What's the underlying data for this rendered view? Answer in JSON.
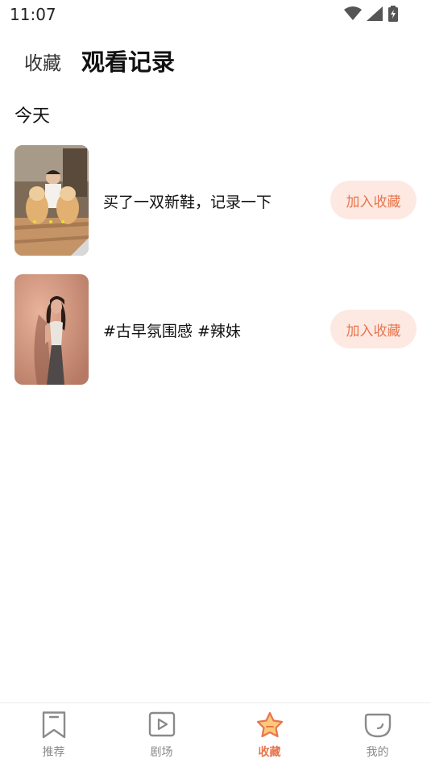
{
  "status": {
    "time": "11:07"
  },
  "header": {
    "tab_favorites": "收藏",
    "tab_history": "观看记录"
  },
  "section": {
    "title": "今天"
  },
  "items": [
    {
      "title": "买了一双新鞋，记录一下",
      "button": "加入收藏"
    },
    {
      "title": "#古早氛围感 #辣妹",
      "button": "加入收藏"
    }
  ],
  "nav": {
    "items": [
      {
        "label": "推荐",
        "icon": "bookmark-icon",
        "active": false
      },
      {
        "label": "剧场",
        "icon": "play-box-icon",
        "active": false
      },
      {
        "label": "收藏",
        "icon": "star-icon",
        "active": true
      },
      {
        "label": "我的",
        "icon": "smile-face-icon",
        "active": false
      }
    ]
  },
  "colors": {
    "accent": "#e8754d",
    "button_bg": "#fde9e2"
  }
}
